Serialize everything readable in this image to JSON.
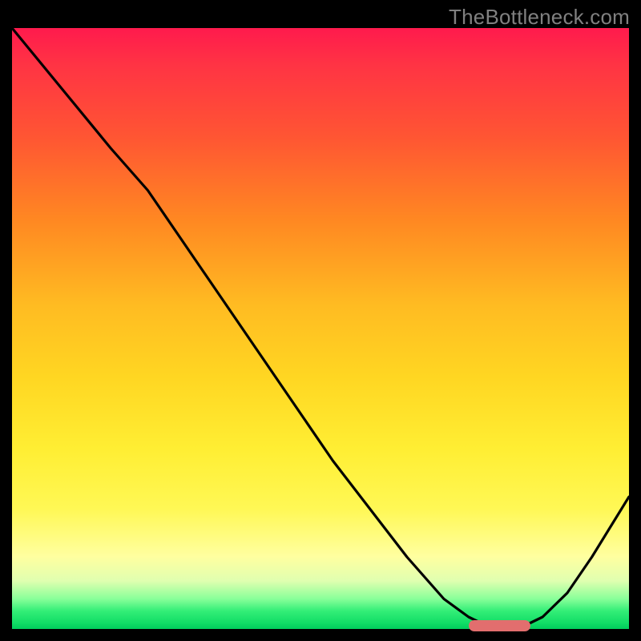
{
  "watermark": "TheBottleneck.com",
  "colors": {
    "background": "#000000",
    "curve_stroke": "#000000",
    "marker_fill": "#e26e6e",
    "gradient_top": "#ff1a4d",
    "gradient_bottom": "#00cc5c"
  },
  "chart_data": {
    "type": "line",
    "title": "",
    "xlabel": "",
    "ylabel": "",
    "xlim": [
      0,
      100
    ],
    "ylim": [
      0,
      100
    ],
    "grid": false,
    "legend": false,
    "series": [
      {
        "name": "bottleneck-curve",
        "x": [
          0,
          8,
          16,
          22,
          28,
          34,
          40,
          46,
          52,
          58,
          64,
          70,
          74,
          78,
          82,
          86,
          90,
          94,
          100
        ],
        "values": [
          100,
          90,
          80,
          73,
          64,
          55,
          46,
          37,
          28,
          20,
          12,
          5,
          2,
          0,
          0,
          2,
          6,
          12,
          22
        ]
      }
    ],
    "minimum_marker": {
      "x_start": 74,
      "x_end": 84,
      "y": 0
    },
    "annotations": []
  }
}
